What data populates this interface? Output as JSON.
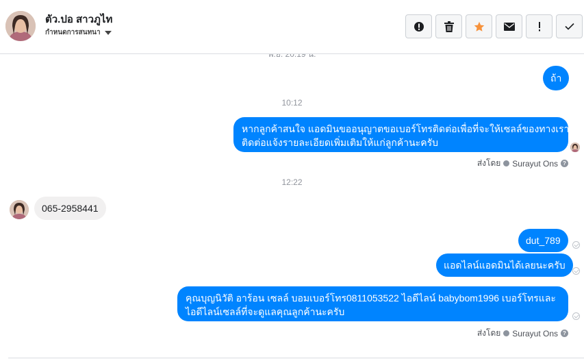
{
  "header": {
    "contact_name": "ตัว.ปอ สาวภูไท",
    "settings_label": "กำหนดการสนทนา"
  },
  "thread": {
    "cut_timestamp": "พ.ย. 20:19 น.",
    "messages": [
      {
        "text": "ถ้า"
      },
      {
        "timestamp": "10:12"
      },
      {
        "line1": "หากลูกค้าสนใจ แอดมินขออนุญาตขอเบอร์โทรติดต่อเพื่อที่จะให้เซลล์ของทางเรา",
        "line2": "ติดต่อแจ้งรายละเอียดเพิ่มเติมให้แก่ลูกค้านะครับ"
      },
      {
        "sent_by_label": "ส่งโดย",
        "sent_by_name": "Surayut Ons"
      },
      {
        "timestamp": "12:22"
      },
      {
        "text": "065-2958441"
      },
      {
        "text": "dut_789"
      },
      {
        "text": "แอดไลน์แอดมินได้เลยนะครับ"
      },
      {
        "line1": "คุณบุญนิวัติ อาร้อน เซลล์ บอมเบอร์โทร0811053522 ไอดีไลน์ babybom1996  เบอร์โทรและ",
        "line2": "ไอดีไลน์เซลล์ที่จะดูแลคุณลูกค้านะครับ"
      },
      {
        "sent_by_label": "ส่งโดย",
        "sent_by_name": "Surayut Ons"
      }
    ]
  },
  "icons": {
    "actions": [
      "alert-circle-icon",
      "trash-icon",
      "star-icon",
      "mail-icon",
      "exclamation-icon",
      "check-icon"
    ],
    "star_color": "#f7923b",
    "accent": "#0084ff"
  }
}
